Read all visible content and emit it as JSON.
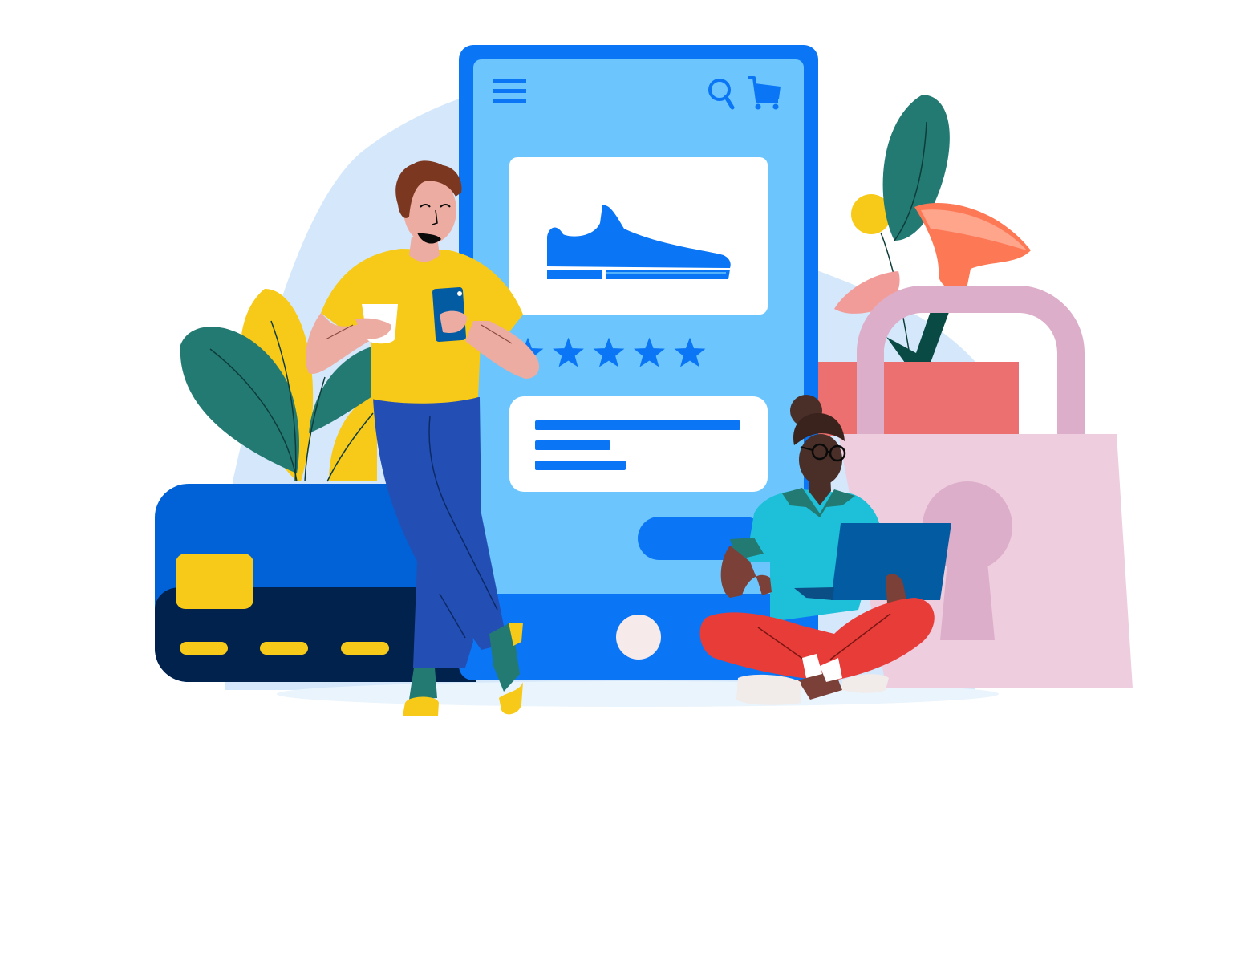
{
  "scene": {
    "subject": "online-shopping-illustration",
    "colors": {
      "background": "#ffffff",
      "blob": "#d5e8fb",
      "phone_frame": "#0a76f5",
      "phone_screen": "#6cc6fd",
      "accent_blue": "#0a76f5",
      "card_blue": "#0062d6",
      "card_navy": "#00224d",
      "yellow": "#f7c918",
      "teal_leaf": "#237a73",
      "bag_pink": "#eecdde",
      "bag_handle": "#ddaec9",
      "box_red": "#ec706f",
      "flower_orange": "#fd7956",
      "flower_pink": "#f29c9a",
      "man_shirt": "#f7c918",
      "man_pants": "#234fb5",
      "woman_shirt": "#1ebfd8",
      "woman_pants": "#e83c39",
      "laptop": "#035ba1",
      "skin_light": "#edaca1",
      "skin_dark": "#7b4038",
      "hair_brown": "#7b3720",
      "hair_dark": "#4a2f29"
    }
  },
  "phone": {
    "menu_icon": "hamburger-menu-icon",
    "search_icon": "search-icon",
    "cart_icon": "shopping-cart-icon",
    "product_icon": "shoe-icon",
    "star_icon": "star-icon",
    "rating": 5,
    "rating_max": 5,
    "home_icon": "home-button-icon"
  },
  "card": {
    "chip_icon": "card-chip-icon"
  },
  "bag": {
    "keyhole_icon": "keyhole-icon"
  }
}
